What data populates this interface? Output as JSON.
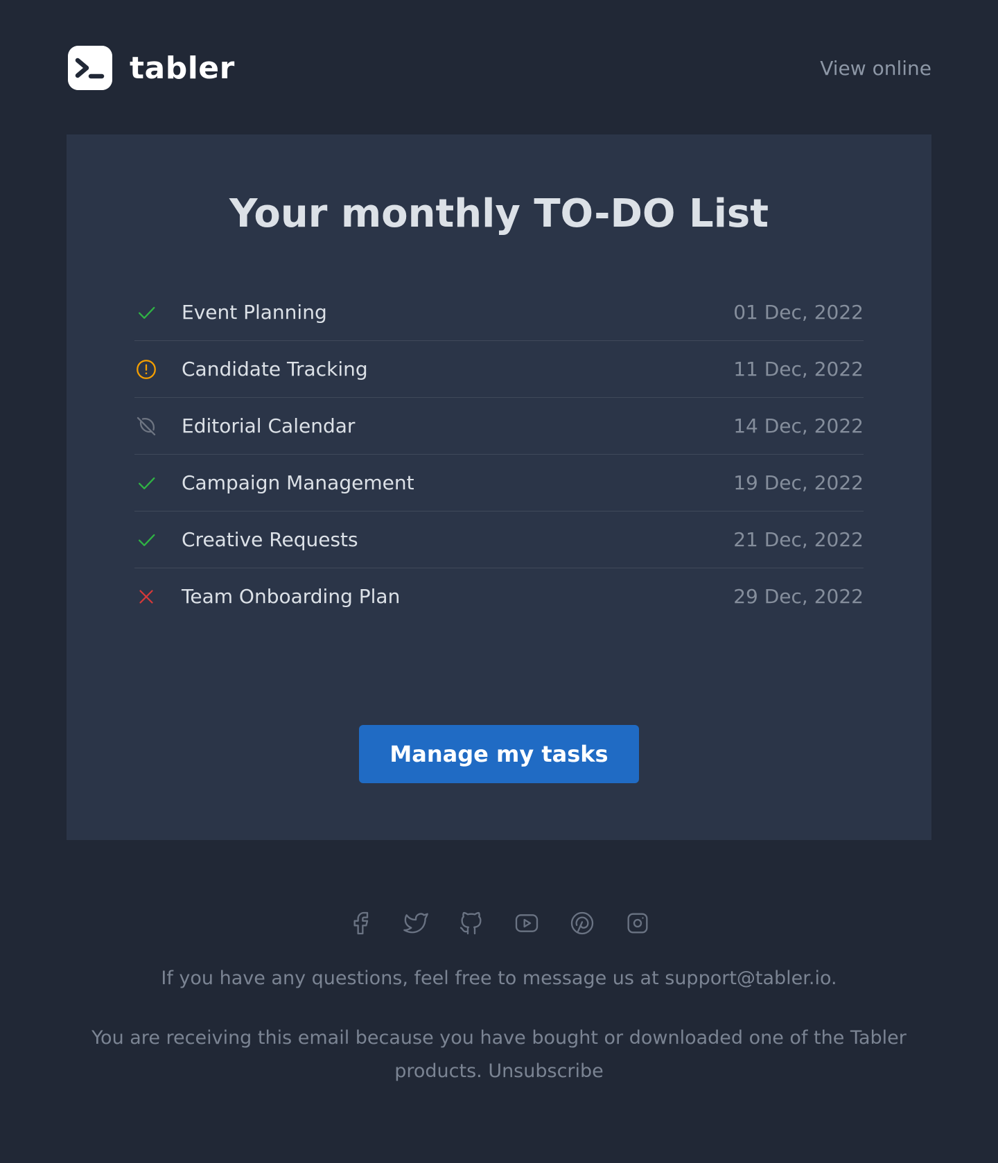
{
  "header": {
    "brand": "tabler",
    "view_online": "View online"
  },
  "card": {
    "title": "Your monthly TO-DO List",
    "tasks": [
      {
        "label": "Event Planning",
        "date": "01 Dec, 2022",
        "status_icon": "check-icon",
        "status_color": "#2fb344"
      },
      {
        "label": "Candidate Tracking",
        "date": "11 Dec, 2022",
        "status_icon": "alert-circle-icon",
        "status_color": "#f59f00"
      },
      {
        "label": "Editorial Calendar",
        "date": "14 Dec, 2022",
        "status_icon": "circle-off-icon",
        "status_color": "#6e7582"
      },
      {
        "label": "Campaign Management",
        "date": "19 Dec, 2022",
        "status_icon": "check-icon",
        "status_color": "#2fb344"
      },
      {
        "label": "Creative Requests",
        "date": "21 Dec, 2022",
        "status_icon": "check-icon",
        "status_color": "#2fb344"
      },
      {
        "label": "Team Onboarding Plan",
        "date": "29 Dec, 2022",
        "status_icon": "x-icon",
        "status_color": "#d63939"
      }
    ],
    "cta_label": "Manage my tasks",
    "cta_color": "#206bc4"
  },
  "footer": {
    "social_icons": [
      "facebook-icon",
      "twitter-icon",
      "github-icon",
      "youtube-icon",
      "pinterest-icon",
      "instagram-icon"
    ],
    "contact_prefix": "If you have any questions, feel free to message us at ",
    "contact_email": "support@tabler.io",
    "contact_suffix": ".",
    "notice_text": "You are receiving this email because you have bought or downloaded one of the Tabler products. ",
    "unsubscribe_label": "Unsubscribe"
  },
  "colors": {
    "page_bg": "#212836",
    "card_bg": "#2b3548",
    "muted_text": "#7b8493"
  }
}
